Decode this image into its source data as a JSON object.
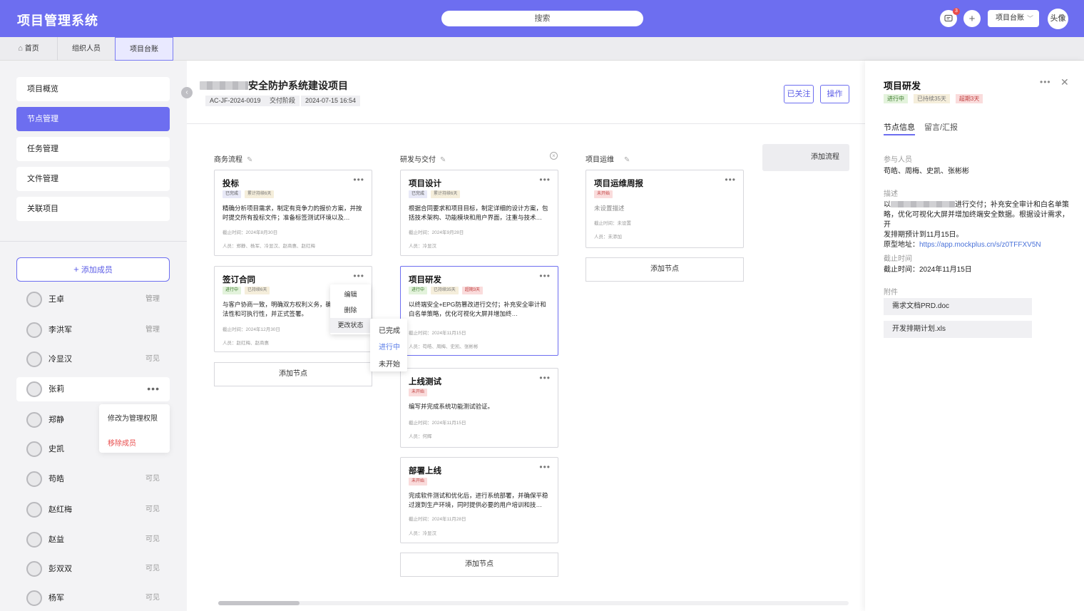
{
  "header": {
    "app_title": "项目管理系统",
    "search_placeholder": "搜索",
    "notification_count": "3",
    "ledger_label": "项目台账",
    "avatar_label": "头像"
  },
  "tabs": [
    "首页",
    "组织人员",
    "项目台账"
  ],
  "sidebar": {
    "nav": [
      "项目概览",
      "节点管理",
      "任务管理",
      "文件管理",
      "关联项目"
    ],
    "add_member": "添加成员",
    "members": [
      {
        "name": "王卓",
        "role": "管理"
      },
      {
        "name": "李洪军",
        "role": "管理"
      },
      {
        "name": "冷显汉",
        "role": "可见"
      },
      {
        "name": "张莉",
        "role": ""
      },
      {
        "name": "郑静",
        "role": ""
      },
      {
        "name": "史凯",
        "role": ""
      },
      {
        "name": "苟皓",
        "role": "可见"
      },
      {
        "name": "赵红梅",
        "role": "可见"
      },
      {
        "name": "赵益",
        "role": "可见"
      },
      {
        "name": "彭双双",
        "role": "可见"
      },
      {
        "name": "杨军",
        "role": "可见"
      }
    ],
    "member_menu": {
      "make_admin": "修改为管理权限",
      "remove": "移除成员"
    }
  },
  "project": {
    "title": "安全防护系统建设项目",
    "code": "AC-JF-2024-0019",
    "phase": "交付阶段",
    "datetime": "2024-07-15  16:54",
    "follow_btn": "已关注",
    "action_btn": "操作"
  },
  "board": {
    "add_flow": "添加流程",
    "add_node": "添加节点",
    "columns": [
      {
        "title": "商务流程",
        "cards": [
          {
            "title": "投标",
            "tags": [
              "已完成",
              "累计持续6天"
            ],
            "desc": "精确分析项目需求，制定有竞争力的报价方案，并按时提交所有投标文件；准备标签测试环境以及…",
            "date": "截止时间：2024年8月30日",
            "people": "人员：郑静、杨军、冷显汉、赵商惠、赵红梅"
          },
          {
            "title": "签订合同",
            "tags": [
              "进行中",
              "已持续6天"
            ],
            "desc": "与客户协商一致，明确双方权利义务，确保合同的合法性和可执行性，并正式签署。",
            "date": "截止时间：2024年12月30日",
            "people": "人员：赵红梅、赵商惠"
          }
        ]
      },
      {
        "title": "研发与交付",
        "cards": [
          {
            "title": "项目设计",
            "tags": [
              "已完成",
              "累计持续6天"
            ],
            "desc": "根据合同要求和项目目标，制定详细的设计方案，包括技术架构、功能模块和用户界面，注重与技术…",
            "date": "截止时间：2024年9月28日",
            "people": "人员：冷显汉"
          },
          {
            "title": "项目研发",
            "tags": [
              "进行中",
              "已持续35天",
              "超期3天"
            ],
            "desc": "以终端安全+EPG防篡改进行交付；补充安全审计和白名单策略，优化可视化大屏并增加终…",
            "date": "截止时间：2024年11月15日",
            "people": "人员：苟皓、周梅、史凯、张彬彬"
          },
          {
            "title": "上线测试",
            "tags": [
              "未开始"
            ],
            "desc": "编写并完成系统功能测试验证。",
            "date": "截止时间：2024年11月15日",
            "people": "人员：何辉"
          },
          {
            "title": "部署上线",
            "tags": [
              "未开始"
            ],
            "desc": "完成软件测试和优化后，进行系统部署，并确保平稳过渡到生产环境，同时提供必要的用户培训和技…",
            "date": "截止时间：2024年11月28日",
            "people": "人员：冷显汉"
          }
        ]
      },
      {
        "title": "项目运维",
        "cards": [
          {
            "title": "项目运维周报",
            "tags": [
              "未开始"
            ],
            "desc": "未设置描述",
            "date": "截止时间：未设置",
            "people": "人员：未添加"
          }
        ]
      }
    ],
    "context_menu": [
      "编辑",
      "删除",
      "更改状态"
    ],
    "status_menu": [
      "已完成",
      "进行中",
      "未开始"
    ]
  },
  "detail": {
    "title": "项目研发",
    "tags": [
      "进行中",
      "已持续35天",
      "超期3天"
    ],
    "tabs": [
      "节点信息",
      "留言/汇报"
    ],
    "participants_label": "参与人员",
    "participants": "苟皓、周梅、史凯、张彬彬",
    "desc_label": "描述",
    "desc_prefix": "以",
    "desc_line1": "进行交付；补充安全审计和白名单策",
    "desc_line2": "略，优化可视化大屏并增加终端安全数据。根据设计需求，开",
    "desc_line3": "发排期预计到11月15日。",
    "proto_label": "原型地址：",
    "proto_link": "https://app.mockplus.cn/s/z0TFFXV5N",
    "deadline_label": "截止时间",
    "deadline": "截止时间：2024年11月15日",
    "attach_label": "附件",
    "files": [
      "需求文档PRD.doc",
      "开发排期计划.xls"
    ]
  },
  "colors": {
    "accent": "#6d6ef0",
    "danger": "#e84b4b",
    "link": "#4a72d9"
  }
}
